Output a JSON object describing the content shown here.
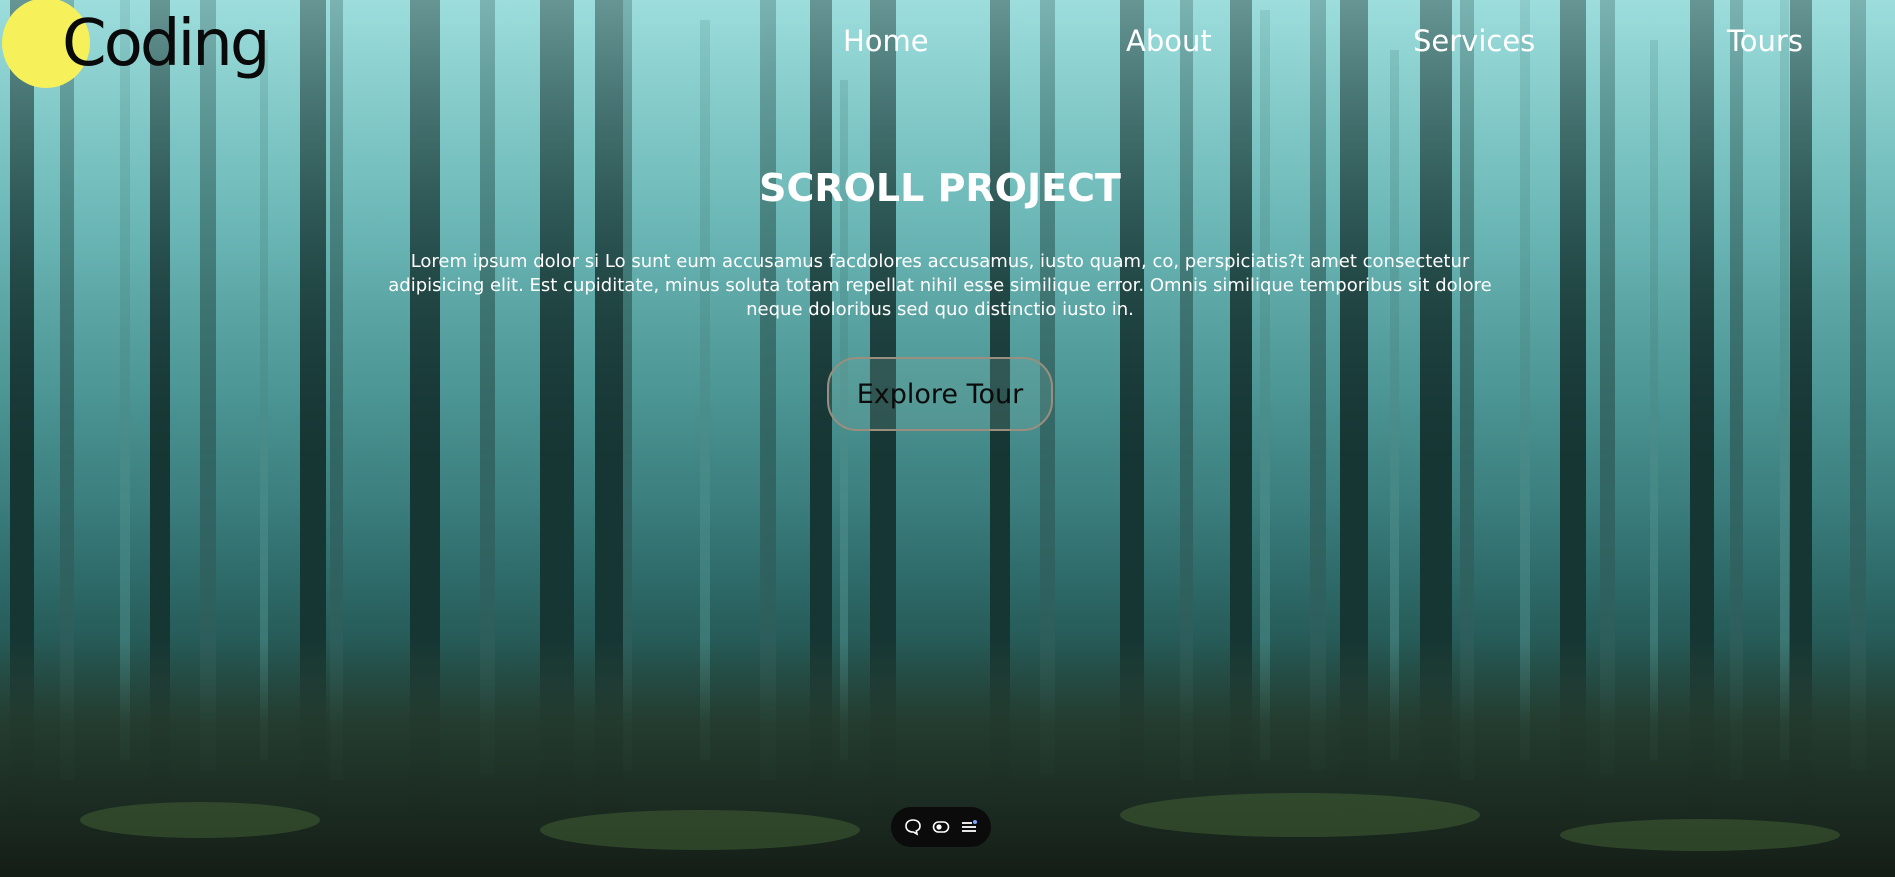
{
  "logo": {
    "text": "Coding"
  },
  "nav": {
    "items": [
      {
        "label": "Home"
      },
      {
        "label": "About"
      },
      {
        "label": "Services"
      },
      {
        "label": "Tours"
      }
    ]
  },
  "hero": {
    "title": "SCROLL PROJECT",
    "description": "Lorem ipsum dolor si Lo sunt eum accusamus facdolores accusamus, iusto quam, co, perspiciatis?t amet consectetur adipisicing elit. Est cupiditate, minus soluta totam repellat nihil esse similique error. Omnis similique temporibus sit dolore neque doloribus sed quo distinctio iusto in.",
    "button_label": "Explore Tour"
  },
  "toolbar": {
    "icons": [
      "chat-bubble-icon",
      "toggle-icon",
      "menu-list-icon"
    ]
  },
  "colors": {
    "logo_circle": "#f6f15a",
    "button_border": "#9a8f7e",
    "text": "#ffffff"
  }
}
